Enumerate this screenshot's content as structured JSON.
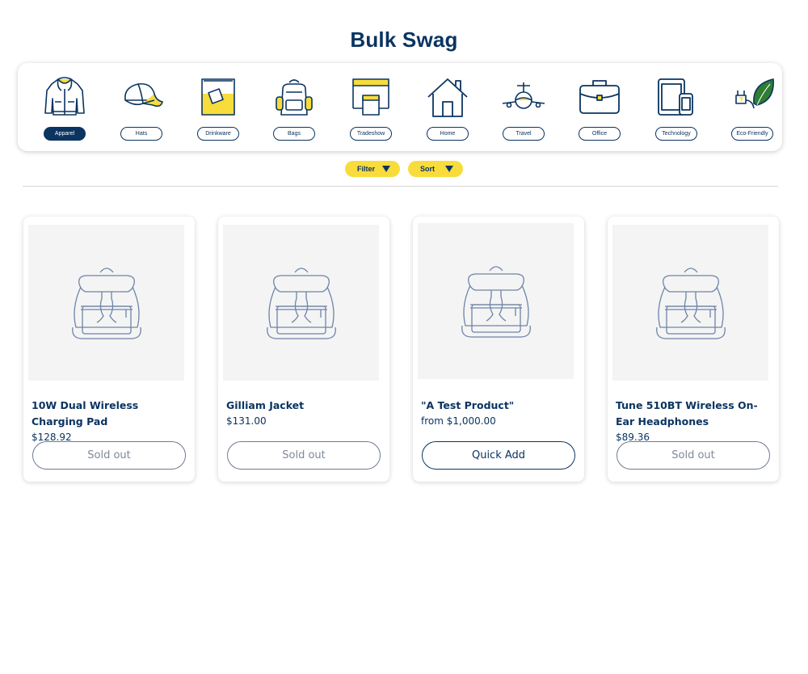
{
  "header": {
    "title": "Bulk Swag"
  },
  "categories": [
    {
      "label": "Apparel",
      "icon": "hoodie-icon",
      "active": true
    },
    {
      "label": "Hats",
      "icon": "cap-icon"
    },
    {
      "label": "Drinkware",
      "icon": "glass-icon"
    },
    {
      "label": "Bags",
      "icon": "backpack-icon"
    },
    {
      "label": "Tradeshow",
      "icon": "booth-icon"
    },
    {
      "label": "Home",
      "icon": "house-icon"
    },
    {
      "label": "Travel",
      "icon": "airplane-icon"
    },
    {
      "label": "Office",
      "icon": "briefcase-icon"
    },
    {
      "label": "Technology",
      "icon": "devices-icon"
    },
    {
      "label": "Eco-Friendly",
      "icon": "leaf-plug-icon"
    }
  ],
  "toolbar": {
    "filter_label": "Filter",
    "sort_label": "Sort"
  },
  "products": [
    {
      "name": "10W Dual Wireless Charging Pad",
      "price": "$128.92",
      "action": "Sold out",
      "sold_out": true
    },
    {
      "name": "Gilliam Jacket",
      "price": "$131.00",
      "action": "Sold out",
      "sold_out": true
    },
    {
      "name": "\"A Test Product\"",
      "price": "from $1,000.00",
      "action": "Quick Add",
      "sold_out": false
    },
    {
      "name": "Tune 510BT Wireless On-Ear Headphones",
      "price": "$89.36",
      "action": "Sold out",
      "sold_out": true
    }
  ],
  "colors": {
    "navy": "#0b3461",
    "yellow": "#f7dc3c",
    "thumb_bg": "#f4f4f4"
  }
}
